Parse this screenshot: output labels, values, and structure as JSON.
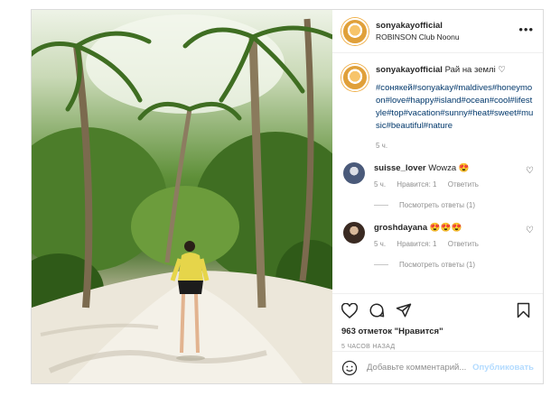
{
  "post": {
    "username": "sonyakayofficial",
    "location": "ROBINSON Club Noonu",
    "more_icon": "more-icon",
    "caption": {
      "username": "sonyakayofficial",
      "text": "Рай на землі ♡",
      "hashtags": "#сонякей#sonyakay#maldives#honeymoon#love#happy#island#ocean#cool#lifestyle#top#vacation#sunny#heat#sweet#music#beautiful#nature",
      "time": "5 ч."
    },
    "comments": [
      {
        "username": "suisse_lover",
        "text": "Wowza 😍",
        "time": "5 ч.",
        "likes": "Нравится: 1",
        "reply": "Ответить",
        "view_replies": "Посмотреть ответы (1)"
      },
      {
        "username": "groshdayana",
        "text": "😍😍😍",
        "time": "5 ч.",
        "likes": "Нравится: 1",
        "reply": "Ответить",
        "view_replies": "Посмотреть ответы (1)"
      }
    ],
    "likes": "963 отметок \"Нравится\"",
    "ago": "5 ЧАСОВ НАЗАД",
    "add_comment": {
      "placeholder": "Добавьте комментарий...",
      "publish": "Опубликовать"
    },
    "colors": {
      "link": "#00376b",
      "muted": "#8e8e8e",
      "publish_disabled": "#b3dbff"
    }
  }
}
